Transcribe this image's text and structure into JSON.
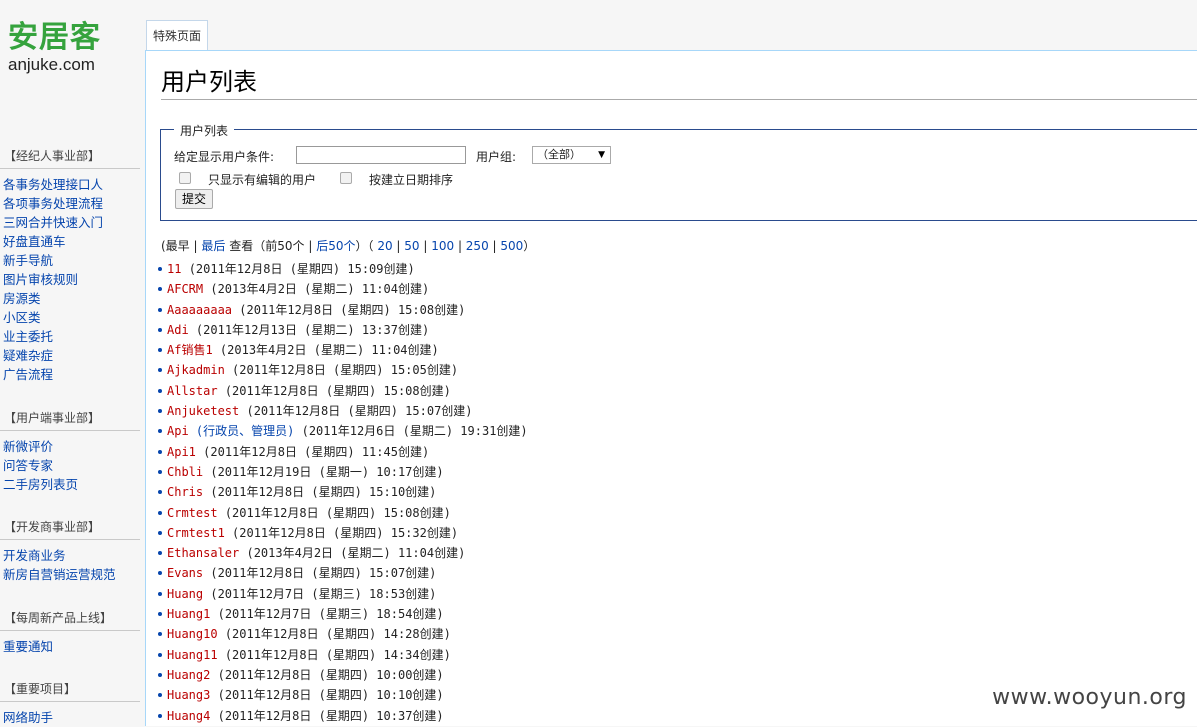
{
  "logo": {
    "cn": "安居客",
    "en": "anjuke.com"
  },
  "sidebar": [
    {
      "heading": "【经纪人事业部】",
      "items": [
        "各事务处理接口人",
        "各项事务处理流程",
        "三网合并快速入门",
        "好盘直通车",
        "新手导航",
        "图片审核规则",
        "房源类",
        "小区类",
        "业主委托",
        "疑难杂症",
        "广告流程"
      ]
    },
    {
      "heading": "【用户端事业部】",
      "items": [
        "新微评价",
        "问答专家",
        "二手房列表页"
      ]
    },
    {
      "heading": "【开发商事业部】",
      "items": [
        "开发商业务",
        "新房自营销运营规范"
      ]
    },
    {
      "heading": "【每周新产品上线】",
      "items": [
        "重要通知"
      ]
    },
    {
      "heading": "【重要项目】",
      "items": [
        "网络助手"
      ]
    }
  ],
  "tab": {
    "label": "特殊页面"
  },
  "page": {
    "title": "用户列表"
  },
  "filter": {
    "legend": "用户列表",
    "condition_label": "给定显示用户条件:",
    "condition_value": "",
    "group_label": "用户组:",
    "group_selected": "（全部）",
    "only_editors_label": "只显示有编辑的用户",
    "sort_by_date_label": "按建立日期排序",
    "submit_label": "提交"
  },
  "pager": {
    "open": "(最早",
    "latest": "最后",
    "view": "查看（前50个",
    "next50": "后50个",
    "counts": [
      "20",
      "50",
      "100",
      "250",
      "500"
    ]
  },
  "users": [
    {
      "name": "11",
      "meta": "(2011年12月8日 (星期四) 15:09创建)",
      "color": "red"
    },
    {
      "name": "AFCRM",
      "meta": "(2013年4月2日 (星期二) 11:04创建)",
      "color": "red"
    },
    {
      "name": "Aaaaaaaaa",
      "meta": "(2011年12月8日 (星期四) 15:08创建)",
      "color": "red"
    },
    {
      "name": "Adi",
      "meta": "(2011年12月13日 (星期二) 13:37创建)",
      "color": "red"
    },
    {
      "name": "Af销售1",
      "meta": "(2013年4月2日 (星期二) 11:04创建)",
      "color": "red"
    },
    {
      "name": "Ajkadmin",
      "meta": "(2011年12月8日 (星期四) 15:05创建)",
      "color": "red"
    },
    {
      "name": "Allstar",
      "meta": "(2011年12月8日 (星期四) 15:08创建)",
      "color": "red"
    },
    {
      "name": "Anjuketest",
      "meta": "(2011年12月8日 (星期四) 15:07创建)",
      "color": "red"
    },
    {
      "name": "Api",
      "meta": "(行政员、管理员)",
      "meta2": "(2011年12月6日 (星期二) 19:31创建)",
      "color": "red"
    },
    {
      "name": "Api1",
      "meta": "(2011年12月8日 (星期四) 11:45创建)",
      "color": "red"
    },
    {
      "name": "Chbli",
      "meta": "(2011年12月19日 (星期一) 10:17创建)",
      "color": "red"
    },
    {
      "name": "Chris",
      "meta": "(2011年12月8日 (星期四) 15:10创建)",
      "color": "red"
    },
    {
      "name": "Crmtest",
      "meta": "(2011年12月8日 (星期四) 15:08创建)",
      "color": "red"
    },
    {
      "name": "Crmtest1",
      "meta": "(2011年12月8日 (星期四) 15:32创建)",
      "color": "red"
    },
    {
      "name": "Ethansaler",
      "meta": "(2013年4月2日 (星期二) 11:04创建)",
      "color": "red"
    },
    {
      "name": "Evans",
      "meta": "(2011年12月8日 (星期四) 15:07创建)",
      "color": "red"
    },
    {
      "name": "Huang",
      "meta": "(2011年12月7日 (星期三) 18:53创建)",
      "color": "red"
    },
    {
      "name": "Huang1",
      "meta": "(2011年12月7日 (星期三) 18:54创建)",
      "color": "red"
    },
    {
      "name": "Huang10",
      "meta": "(2011年12月8日 (星期四) 14:28创建)",
      "color": "red"
    },
    {
      "name": "Huang11",
      "meta": "(2011年12月8日 (星期四) 14:34创建)",
      "color": "red"
    },
    {
      "name": "Huang2",
      "meta": "(2011年12月8日 (星期四) 10:00创建)",
      "color": "red"
    },
    {
      "name": "Huang3",
      "meta": "(2011年12月8日 (星期四) 10:10创建)",
      "color": "red"
    },
    {
      "name": "Huang4",
      "meta": "(2011年12月8日 (星期四) 10:37创建)",
      "color": "red"
    }
  ],
  "watermark": "www.wooyun.org",
  "colors": {
    "link": "#0645ad",
    "redlink": "#ba0000",
    "logo_green": "#35a33d",
    "border": "#a7d7f9"
  }
}
